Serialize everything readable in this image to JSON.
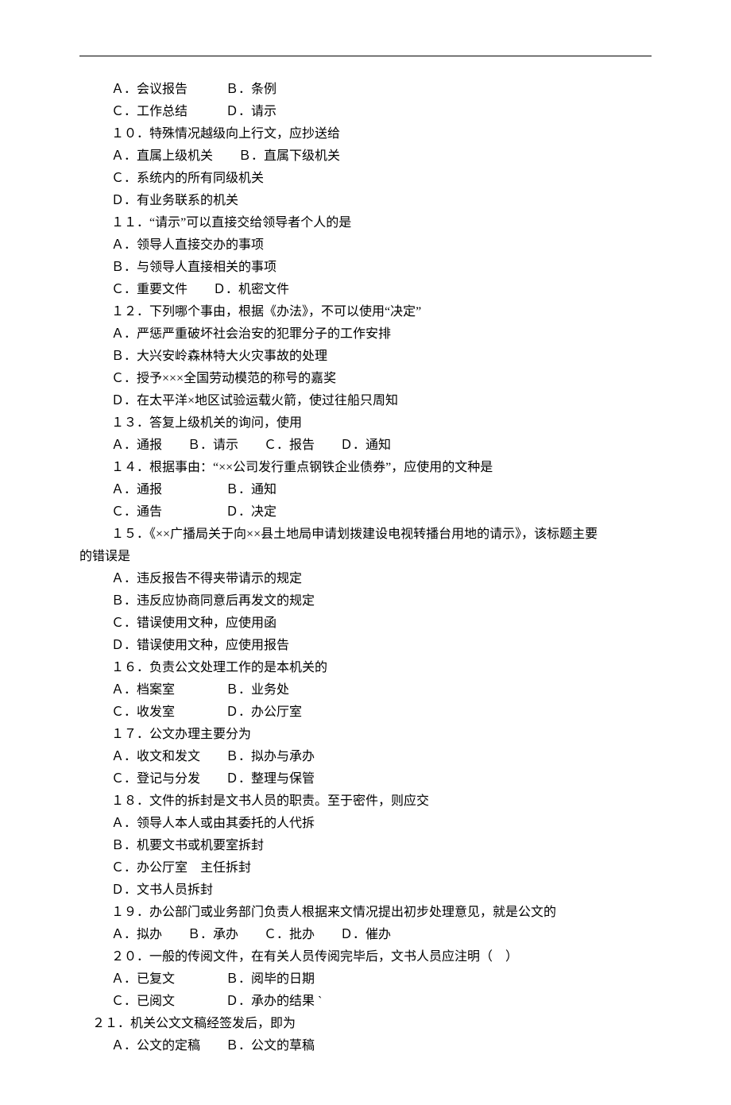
{
  "lines": [
    "Ａ．会议报告　　　Ｂ．条例",
    "Ｃ．工作总结　　　Ｄ．请示",
    "１０．特殊情况越级向上行文，应抄送给　",
    "Ａ．直属上级机关　　Ｂ．直属下级机关",
    "Ｃ．系统内的所有同级机关",
    "Ｄ．有业务联系的机关",
    "１１．“请示”可以直接交给领导者个人的是",
    "Ａ．领导人直接交办的事项",
    "Ｂ．与领导人直接相关的事项",
    "Ｃ．重要文件　　Ｄ．机密文件",
    "１２．下列哪个事由，根据《办法》，不可以使用“决定”",
    "Ａ．严惩严重破坏社会治安的犯罪分子的工作安排",
    "Ｂ．大兴安岭森林特大火灾事故的处理",
    "Ｃ．授予×××全国劳动模范的称号的嘉奖",
    "Ｄ．在太平洋×地区试验运载火箭，使过往船只周知",
    "１３．答复上级机关的询问，使用",
    "Ａ．通报　　Ｂ．请示　　Ｃ．报告　　Ｄ．通知",
    "１４．根据事由：“××公司发行重点钢铁企业债券”，应使用的文种是",
    "Ａ．通报　　　　　Ｂ．通知",
    "Ｃ．通告　　　　　Ｄ．决定",
    "１５．《××广播局关于向××县土地局申请划拨建设电视转播台用地的请示》，该标题主要"
  ],
  "cont15": "的错误是",
  "after15": [
    "Ａ．违反报告不得夹带请示的规定",
    "Ｂ．违反应协商同意后再发文的规定",
    "Ｃ．错误使用文种，应使用函",
    "Ｄ．错误使用文种，应使用报告",
    "１６．负责公文处理工作的是本机关的",
    "Ａ．档案室　　　　Ｂ．业务处",
    "Ｃ．收发室　　　　Ｄ．办公厅室",
    "１７．公文办理主要分为",
    "Ａ．收文和发文　　Ｂ．拟办与承办",
    "Ｃ．登记与分发　　Ｄ．整理与保管",
    "１８．文件的拆封是文书人员的职责。至于密件，则应交",
    "Ａ．领导人本人或由其委托的人代拆",
    "Ｂ．机要文书或机要室拆封",
    "Ｃ．办公厅室　主任拆封",
    "Ｄ．文书人员拆封",
    "１９．办公部门或业务部门负责人根据来文情况提出初步处理意见，就是公文的",
    "Ａ．拟办　　Ｂ．承办　　Ｃ．批办　　Ｄ．催办",
    "２０．一般的传阅文件，在有关人员传阅完毕后，文书人员应注明（　）",
    "Ａ．已复文　　　　Ｂ．阅毕的日期",
    "Ｃ．已阅文　　　　Ｄ．承办的结果 `"
  ],
  "q21stem": "２１．机关公文文稿经签发后，即为",
  "q21opts": "Ａ．公文的定稿　　Ｂ．公文的草稿"
}
